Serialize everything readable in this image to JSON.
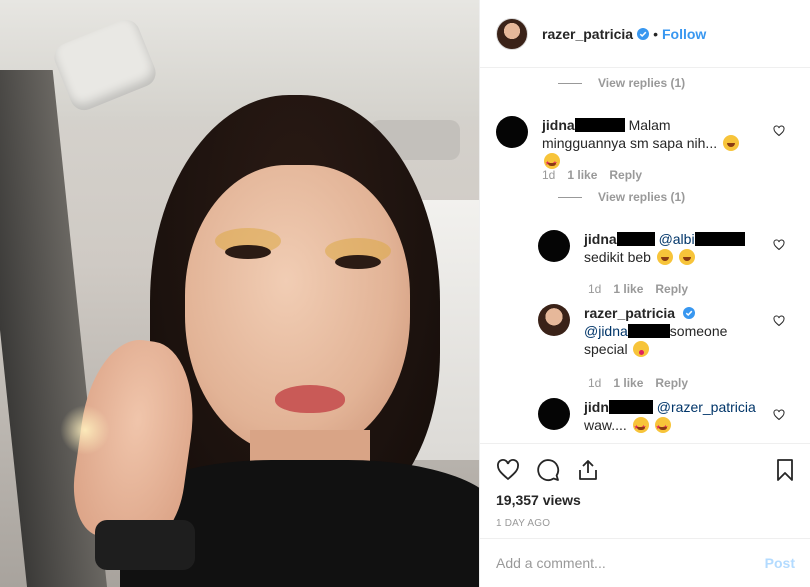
{
  "header": {
    "username": "razer_patricia",
    "separator": "•",
    "follow_label": "Follow",
    "verified_icon": "verified-badge-icon"
  },
  "comments": {
    "view_replies_top": "View replies (1)",
    "items": [
      {
        "username_prefix": "jidna",
        "text": "Malam mingguannya sm sapa nih...",
        "emojis": [
          "grinning-squinting-face",
          "star-struck"
        ],
        "time": "1d",
        "likes": "1 like",
        "reply": "Reply",
        "view_replies": "View replies (1)"
      },
      {
        "username_prefix": "jidna",
        "mention_prefix": "@albi",
        "text": "sedikit beb",
        "emojis": [
          "grinning-squinting-face",
          "grinning-squinting-face"
        ],
        "time": "1d",
        "likes": "1 like",
        "reply": "Reply"
      },
      {
        "username": "razer_patricia",
        "mention_prefix": "@jidna",
        "text_after_mention": "someone",
        "text_line2": "special",
        "emojis": [
          "zany-face"
        ],
        "time": "1d",
        "likes": "1 like",
        "reply": "Reply"
      },
      {
        "username_prefix": "jidn",
        "mention": "@razer_patricia",
        "text": "waw....",
        "emojis": [
          "star-struck",
          "star-struck"
        ]
      }
    ]
  },
  "actions": {
    "icons": [
      "heart-icon",
      "comment-icon",
      "share-icon",
      "bookmark-icon"
    ],
    "views": "19,357 views",
    "time_ago": "1 DAY AGO"
  },
  "add_comment": {
    "placeholder": "Add a comment...",
    "post_label": "Post"
  },
  "colors": {
    "link_blue": "#3897f0",
    "post_disabled": "#b3dbff",
    "secondary_text": "#999999",
    "mention": "#003569"
  }
}
